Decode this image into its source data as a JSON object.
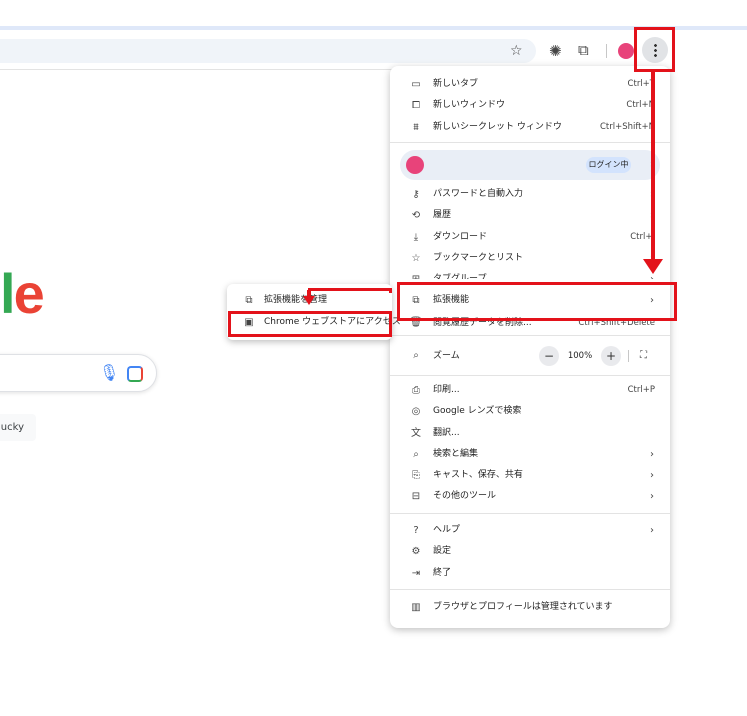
{
  "toolbar": {
    "icons": [
      "star-icon",
      "extension-icon",
      "puzzle-icon",
      "avatar",
      "kebab-icon"
    ],
    "accent_color": "#e8437a"
  },
  "page": {
    "logo_fragment_l": "l",
    "logo_fragment_e": "e",
    "lucky_button": "ucky"
  },
  "menu": {
    "items_top": [
      {
        "icon": "new-tab-icon",
        "label": "新しいタブ",
        "shortcut": "Ctrl+T"
      },
      {
        "icon": "new-window-icon",
        "label": "新しいウィンドウ",
        "shortcut": "Ctrl+N"
      },
      {
        "icon": "incognito-icon",
        "label": "新しいシークレット ウィンドウ",
        "shortcut": "Ctrl+Shift+N"
      }
    ],
    "profile": {
      "status": "ログイン中"
    },
    "items_mid": [
      {
        "icon": "key-icon",
        "label": "パスワードと自動入力",
        "shortcut": ""
      },
      {
        "icon": "history-icon",
        "label": "履歴",
        "shortcut": ""
      },
      {
        "icon": "download-icon",
        "label": "ダウンロード",
        "shortcut": "Ctrl+J"
      },
      {
        "icon": "bookmark-star-icon",
        "label": "ブックマークとリスト",
        "shortcut": ""
      },
      {
        "icon": "tab-groups-icon",
        "label": "タブグループ",
        "shortcut": ""
      },
      {
        "icon": "extension-icon",
        "label": "拡張機能",
        "shortcut": ""
      },
      {
        "icon": "trash-icon",
        "label": "閲覧履歴データを削除...",
        "shortcut": "Ctrl+Shift+Delete"
      }
    ],
    "zoom": {
      "label": "ズーム",
      "value": "100%",
      "minus": "−",
      "plus": "+"
    },
    "items_tools": [
      {
        "icon": "print-icon",
        "label": "印刷...",
        "shortcut": "Ctrl+P"
      },
      {
        "icon": "lens-icon",
        "label": "Google レンズで検索",
        "shortcut": ""
      },
      {
        "icon": "translate-icon",
        "label": "翻訳...",
        "shortcut": ""
      },
      {
        "icon": "find-edit-icon",
        "label": "検索と編集",
        "shortcut": ""
      },
      {
        "icon": "cast-icon",
        "label": "キャスト、保存、共有",
        "shortcut": ""
      },
      {
        "icon": "toolbox-icon",
        "label": "その他のツール",
        "shortcut": ""
      }
    ],
    "items_bottom": [
      {
        "icon": "help-icon",
        "label": "ヘルプ",
        "shortcut": ""
      },
      {
        "icon": "settings-gear-icon",
        "label": "設定",
        "shortcut": ""
      },
      {
        "icon": "exit-icon",
        "label": "終了",
        "shortcut": ""
      }
    ],
    "managed": {
      "icon": "building-icon",
      "label": "ブラウザとプロフィールは管理されています"
    }
  },
  "submenu": {
    "items": [
      {
        "icon": "puzzle-icon",
        "label": "拡張機能を管理"
      },
      {
        "icon": "webstore-icon",
        "label": "Chrome ウェブストアにアクセス"
      }
    ]
  },
  "annotations": {
    "highlight_color": "#e3121a"
  }
}
